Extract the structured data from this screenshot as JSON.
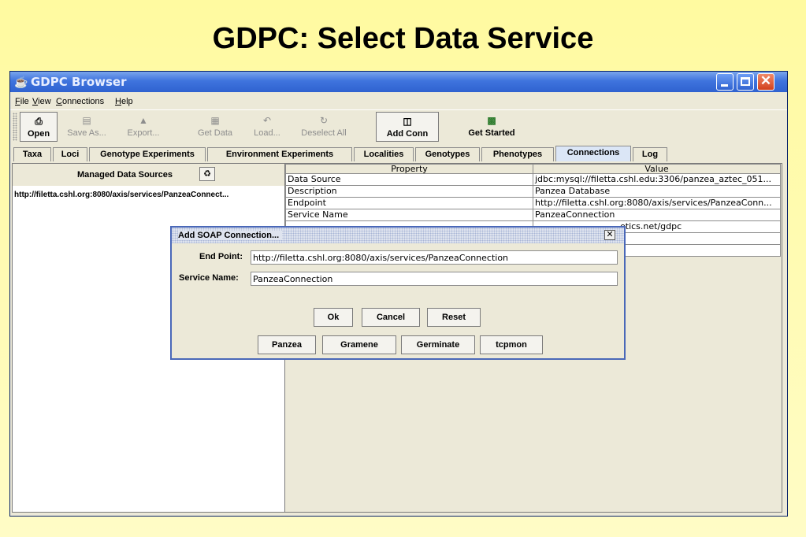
{
  "slide": {
    "title": "GDPC: Select Data Service"
  },
  "window": {
    "title": "GDPC Browser",
    "app_icon": "java-cup-icon"
  },
  "menu": {
    "items": [
      "File",
      "View",
      "Connections",
      "Help"
    ]
  },
  "toolbar": {
    "open": "Open",
    "save_as": "Save As...",
    "export": "Export...",
    "get_data": "Get Data",
    "load": "Load...",
    "deselect_all": "Deselect All",
    "add_conn": "Add Conn",
    "get_started": "Get Started"
  },
  "tabs": [
    "Taxa",
    "Loci",
    "Genotype Experiments",
    "Environment Experiments",
    "Localities",
    "Genotypes",
    "Phenotypes",
    "Connections",
    "Log"
  ],
  "active_tab": "Connections",
  "left_panel": {
    "header": "Managed Data Sources",
    "items": [
      "http://filetta.cshl.org:8080/axis/services/PanzeaConnect..."
    ]
  },
  "properties": {
    "headers": [
      "Property",
      "Value"
    ],
    "rows": [
      [
        "Data Source",
        "jdbc:mysql://filetta.cshl.edu:3306/panzea_aztec_051..."
      ],
      [
        "Description",
        "Panzea Database"
      ],
      [
        "Endpoint",
        "http://filetta.cshl.org:8080/axis/services/PanzeaConn..."
      ],
      [
        "Service Name",
        "PanzeaConnection"
      ],
      [
        "",
        "etics.net/gdpc"
      ],
      [
        "",
        ""
      ],
      [
        "",
        ""
      ]
    ]
  },
  "dialog": {
    "title": "Add SOAP Connection...",
    "end_point_label": "End Point:",
    "end_point_value": "http://filetta.cshl.org:8080/axis/services/PanzeaConnection",
    "service_name_label": "Service Name:",
    "service_name_value": "PanzeaConnection",
    "buttons": [
      "Ok",
      "Cancel",
      "Reset"
    ],
    "presets": [
      "Panzea",
      "Gramene",
      "Germinate",
      "tcpmon"
    ]
  },
  "colors": {
    "titlebar": "#2f62d0",
    "dialog_border": "#4a68b8",
    "slide_bg": "#fffaa0"
  }
}
